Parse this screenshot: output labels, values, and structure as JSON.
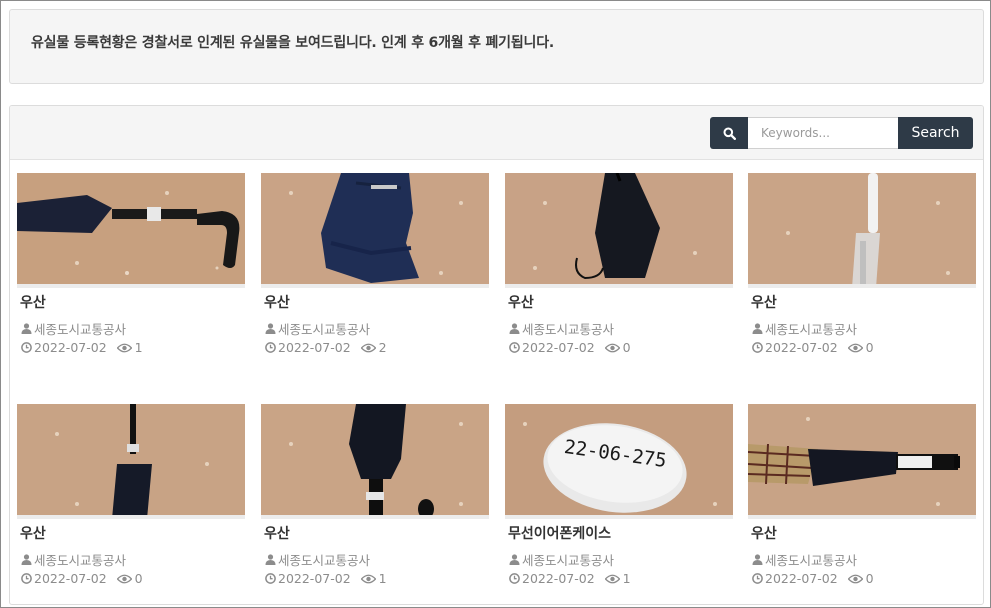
{
  "notice": {
    "text": "유실물 등록현황은 경찰서로 인계된 유실물을 보여드립니다. 인계 후 6개월 후 폐기됩니다."
  },
  "search": {
    "placeholder": "Keywords...",
    "button_label": "Search",
    "icon": "search-icon"
  },
  "colors": {
    "button_bg": "#2e3a47",
    "panel_bg": "#f5f5f5",
    "meta_text": "#8c8c8c"
  },
  "items": [
    {
      "title": "우산",
      "org": "세종도시교통공사",
      "date": "2022-07-02",
      "views": "1"
    },
    {
      "title": "우산",
      "org": "세종도시교통공사",
      "date": "2022-07-02",
      "views": "2"
    },
    {
      "title": "우산",
      "org": "세종도시교통공사",
      "date": "2022-07-02",
      "views": "0"
    },
    {
      "title": "우산",
      "org": "세종도시교통공사",
      "date": "2022-07-02",
      "views": "0"
    },
    {
      "title": "우산",
      "org": "세종도시교통공사",
      "date": "2022-07-02",
      "views": "0"
    },
    {
      "title": "우산",
      "org": "세종도시교통공사",
      "date": "2022-07-02",
      "views": "1"
    },
    {
      "title": "무선이어폰케이스",
      "org": "세종도시교통공사",
      "date": "2022-07-02",
      "views": "1",
      "tag_text": "22-06-275"
    },
    {
      "title": "우산",
      "org": "세종도시교통공사",
      "date": "2022-07-02",
      "views": "0"
    }
  ]
}
